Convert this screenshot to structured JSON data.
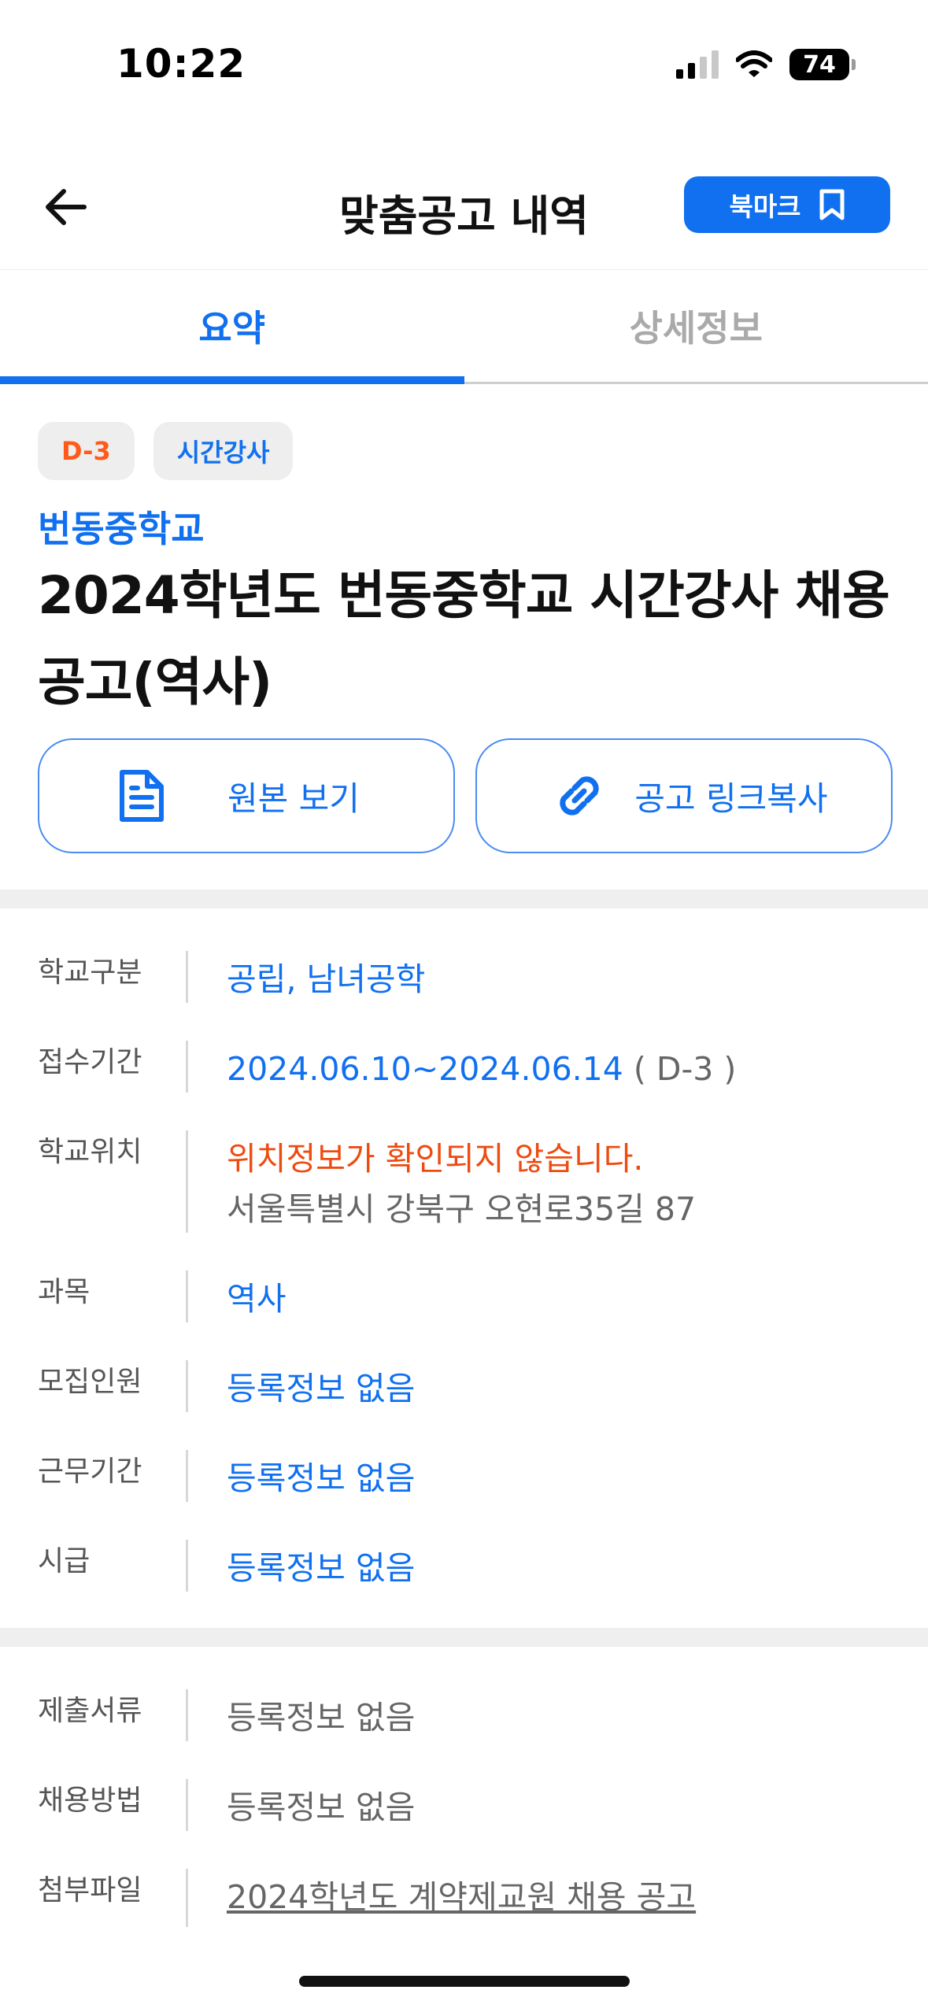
{
  "status_bar": {
    "time": "10:22",
    "battery": "74"
  },
  "header": {
    "title": "맞춤공고 내역",
    "bookmark_label": "북마크"
  },
  "tabs": [
    {
      "label": "요약",
      "active": true
    },
    {
      "label": "상세정보",
      "active": false
    }
  ],
  "summary": {
    "badge_dday": "D-3",
    "badge_type": "시간강사",
    "school_name": "번동중학교",
    "title": "2024학년도 번동중학교 시간강사 채용 공고(역사)"
  },
  "actions": {
    "view_original": "원본 보기",
    "copy_link": "공고 링크복사"
  },
  "info": {
    "school_type": {
      "label": "학교구분",
      "value": "공립, 남녀공학"
    },
    "period": {
      "label": "접수기간",
      "value": "2024.06.10~2024.06.14",
      "suffix": " ( D-3 )"
    },
    "location": {
      "label": "학교위치",
      "warning": "위치정보가 확인되지 않습니다.",
      "address": "서울특별시 강북구 오현로35길 87"
    },
    "subject": {
      "label": "과목",
      "value": "역사"
    },
    "recruits": {
      "label": "모집인원",
      "value": "등록정보 없음"
    },
    "work_period": {
      "label": "근무기간",
      "value": "등록정보 없음"
    },
    "hourly_pay": {
      "label": "시급",
      "value": "등록정보 없음"
    }
  },
  "info2": {
    "documents": {
      "label": "제출서류",
      "value": "등록정보 없음"
    },
    "method": {
      "label": "채용방법",
      "value": "등록정보 없음"
    },
    "attachment": {
      "label": "첨부파일",
      "value": "2024학년도 계약제교원 채용 공고"
    }
  },
  "colors": {
    "accent": "#1170f0",
    "warning": "#ee4b10",
    "badge_dday": "#ff5a1a"
  }
}
